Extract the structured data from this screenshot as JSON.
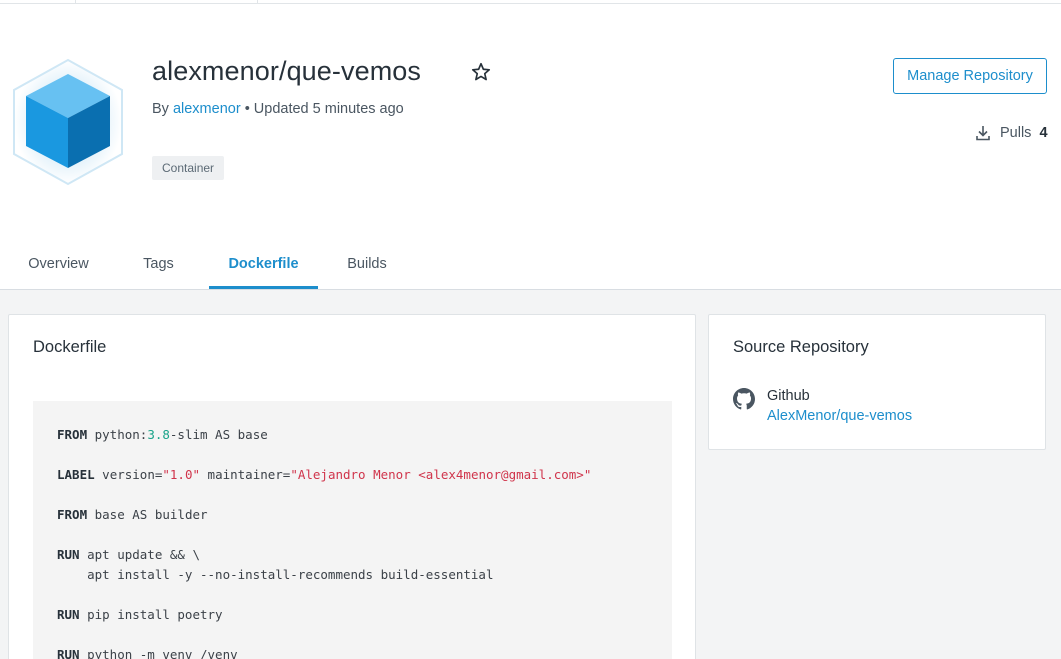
{
  "repo": {
    "title": "alexmenor/que-vemos",
    "by_label": "By",
    "author": "alexmenor",
    "updated": "• Updated 5 minutes ago",
    "badge": "Container",
    "manage_label": "Manage Repository",
    "pulls_label": "Pulls",
    "pulls_count": "4",
    "star_icon": "star-outline-icon",
    "download_icon": "download-icon"
  },
  "tabs": [
    {
      "label": "Overview",
      "active": false
    },
    {
      "label": "Tags",
      "active": false
    },
    {
      "label": "Dockerfile",
      "active": true
    },
    {
      "label": "Builds",
      "active": false
    }
  ],
  "dockerfile": {
    "title": "Dockerfile",
    "lines": [
      [
        {
          "t": "FROM",
          "c": "kw"
        },
        {
          "t": " python:"
        },
        {
          "t": "3.8",
          "c": "num"
        },
        {
          "t": "-slim AS base"
        }
      ],
      [],
      [
        {
          "t": "LABEL",
          "c": "kw"
        },
        {
          "t": " version="
        },
        {
          "t": "\"1.0\"",
          "c": "str"
        },
        {
          "t": " maintainer="
        },
        {
          "t": "\"Alejandro Menor <alex4menor@gmail.com>\"",
          "c": "str"
        }
      ],
      [],
      [
        {
          "t": "FROM",
          "c": "kw"
        },
        {
          "t": " base AS builder"
        }
      ],
      [],
      [
        {
          "t": "RUN",
          "c": "kw"
        },
        {
          "t": " apt update && \\"
        }
      ],
      [
        {
          "t": "    apt install -y --no-install-recommends build-essential"
        }
      ],
      [],
      [
        {
          "t": "RUN",
          "c": "kw"
        },
        {
          "t": " pip install poetry"
        }
      ],
      [],
      [
        {
          "t": "RUN",
          "c": "kw"
        },
        {
          "t": " python -m venv /venv"
        }
      ]
    ]
  },
  "source": {
    "title": "Source Repository",
    "provider": "Github",
    "link": "AlexMenor/que-vemos",
    "icon": "github-icon"
  },
  "colors": {
    "accent": "#1d8ecc",
    "string": "#d0344b",
    "number": "#1aa38a"
  }
}
